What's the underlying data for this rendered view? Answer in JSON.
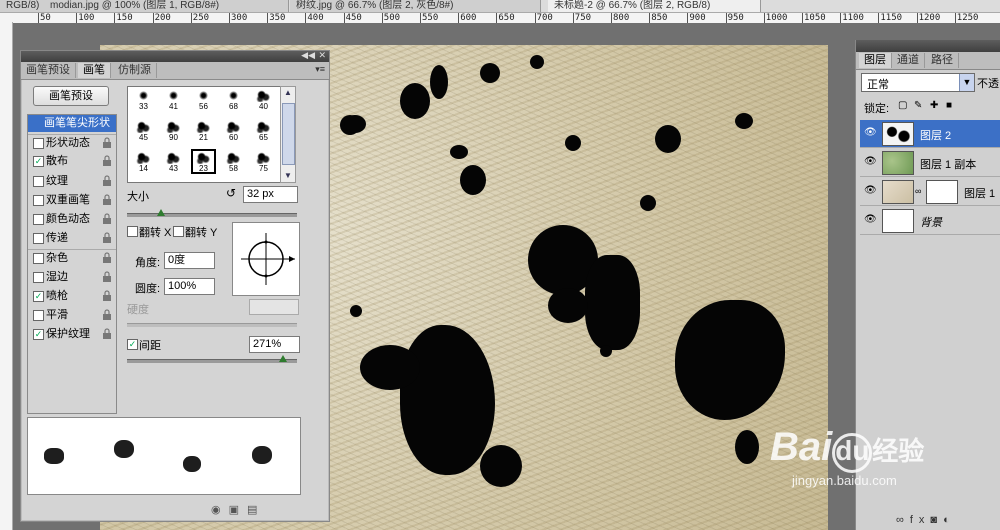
{
  "doc_tabs": [
    {
      "label": "RGB/8)",
      "active": false
    },
    {
      "label": "modian.jpg @ 100% (图层 1, RGB/8#)",
      "active": false
    },
    {
      "label": "树纹.jpg @ 66.7% (图层 2, 灰色/8#)",
      "active": false
    },
    {
      "label": "未标题-2 @ 66.7% (图层 2, RGB/8)",
      "active": true
    }
  ],
  "ruler_labels": [
    "50",
    "100",
    "150",
    "200",
    "250",
    "300",
    "350",
    "400",
    "450",
    "500",
    "550",
    "600",
    "650",
    "700",
    "750",
    "800",
    "850",
    "900",
    "950",
    "1000",
    "1050",
    "1100",
    "1150",
    "1200",
    "1250"
  ],
  "brush_panel": {
    "tabs": [
      {
        "label": "画笔预设",
        "active": false
      },
      {
        "label": "画笔",
        "active": true
      },
      {
        "label": "仿制源",
        "active": false
      }
    ],
    "preset_button": "画笔预设",
    "options": [
      {
        "label": "画笔笔尖形状",
        "checked": null,
        "selected": true,
        "lock": false
      },
      {
        "label": "形状动态",
        "checked": false,
        "selected": false,
        "lock": true
      },
      {
        "label": "散布",
        "checked": true,
        "selected": false,
        "lock": true
      },
      {
        "label": "纹理",
        "checked": false,
        "selected": false,
        "lock": true
      },
      {
        "label": "双重画笔",
        "checked": false,
        "selected": false,
        "lock": true
      },
      {
        "label": "颜色动态",
        "checked": false,
        "selected": false,
        "lock": true
      },
      {
        "label": "传递",
        "checked": false,
        "selected": false,
        "lock": true
      },
      {
        "label": "杂色",
        "checked": false,
        "selected": false,
        "lock": true
      },
      {
        "label": "湿边",
        "checked": false,
        "selected": false,
        "lock": true
      },
      {
        "label": "喷枪",
        "checked": true,
        "selected": false,
        "lock": true
      },
      {
        "label": "平滑",
        "checked": false,
        "selected": false,
        "lock": true
      },
      {
        "label": "保护纹理",
        "checked": true,
        "selected": false,
        "lock": true
      }
    ],
    "brush_tips": [
      {
        "size": "33",
        "kind": "dot"
      },
      {
        "size": "41",
        "kind": "dot"
      },
      {
        "size": "56",
        "kind": "dot"
      },
      {
        "size": "68",
        "kind": "dot"
      },
      {
        "size": "40",
        "kind": "splat"
      },
      {
        "size": "45",
        "kind": "splat"
      },
      {
        "size": "90",
        "kind": "splat"
      },
      {
        "size": "21",
        "kind": "splat"
      },
      {
        "size": "60",
        "kind": "splat"
      },
      {
        "size": "65",
        "kind": "splat"
      },
      {
        "size": "14",
        "kind": "splat"
      },
      {
        "size": "43",
        "kind": "splat"
      },
      {
        "size": "23",
        "kind": "splat",
        "selected": true
      },
      {
        "size": "58",
        "kind": "splat"
      },
      {
        "size": "75",
        "kind": "splat"
      }
    ],
    "size_label": "大小",
    "size_value": "32 px",
    "size_slider_level": 0.2,
    "flip_x_label": "翻转 X",
    "flip_y_label": "翻转 Y",
    "flip_x": false,
    "flip_y": false,
    "angle_label": "角度:",
    "angle_value": "0度",
    "roundness_label": "圆度:",
    "roundness_value": "100%",
    "hardness_label": "硬度",
    "spacing_label": "间距",
    "spacing_checked": true,
    "spacing_value": "271%",
    "spacing_slider_level": 0.92
  },
  "layers_panel": {
    "tabs": [
      {
        "label": "图层",
        "active": true
      },
      {
        "label": "通道",
        "active": false
      },
      {
        "label": "路径",
        "active": false
      }
    ],
    "blend_mode": "正常",
    "opacity_label": "不透",
    "lock_label": "锁定:",
    "layers": [
      {
        "name": "图层 2",
        "selected": true,
        "thumb": "splatter"
      },
      {
        "name": "图层 1 副本",
        "selected": false,
        "thumb": "green"
      },
      {
        "name": "图层 1",
        "selected": false,
        "thumb": "texture",
        "mask": true
      },
      {
        "name": "背景",
        "selected": false,
        "thumb": "white"
      }
    ]
  },
  "watermark": {
    "brand": "Bai",
    "brand2": "du",
    "tail": "经验",
    "url": "jingyan.baidu.com"
  }
}
